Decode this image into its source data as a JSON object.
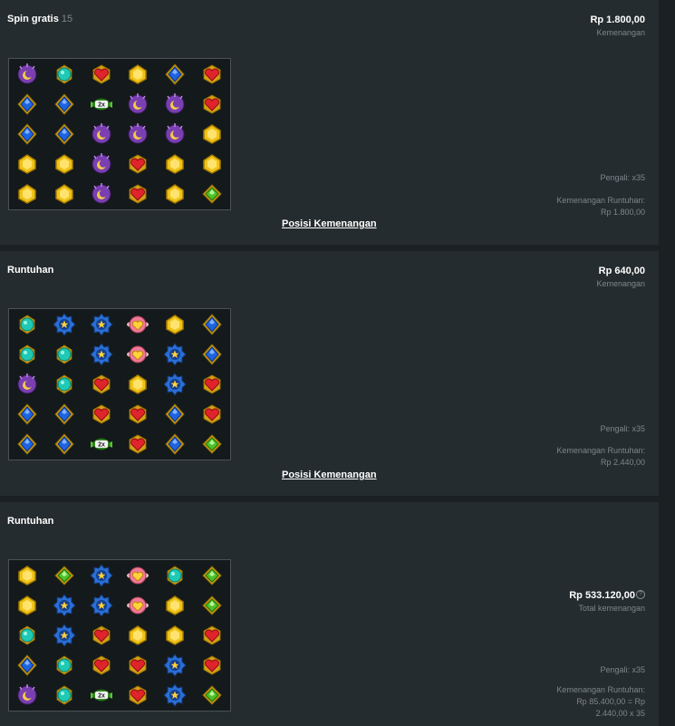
{
  "rounds": [
    {
      "title": "Spin gratis",
      "count": "15",
      "amount": "Rp 1.800,00",
      "amount_label": "Kemenangan",
      "multiplier": "Pengali: x35",
      "cascade_label": "Kemenangan Runtuhan:",
      "cascade_value": "Rp 1.800,00",
      "link": "Posisi Kemenangan",
      "grid": [
        [
          "purple-moon",
          "teal-orb",
          "red-heart",
          "yellow-gem",
          "blue-diamond",
          "red-heart"
        ],
        [
          "blue-diamond",
          "blue-diamond",
          "wild-2x",
          "purple-moon",
          "purple-moon",
          "red-heart"
        ],
        [
          "blue-diamond",
          "blue-diamond",
          "purple-moon",
          "purple-moon",
          "purple-moon",
          "yellow-gem"
        ],
        [
          "yellow-gem",
          "yellow-gem",
          "purple-moon",
          "red-heart",
          "yellow-gem",
          "yellow-gem"
        ],
        [
          "yellow-gem",
          "yellow-gem",
          "purple-moon",
          "red-heart",
          "yellow-gem",
          "green-emerald"
        ]
      ]
    },
    {
      "title": "Runtuhan",
      "amount": "Rp 640,00",
      "amount_label": "Kemenangan",
      "multiplier": "Pengali: x35",
      "cascade_label": "Kemenangan Runtuhan:",
      "cascade_value": "Rp 2.440,00",
      "link": "Posisi Kemenangan",
      "grid": [
        [
          "teal-orb",
          "blue-star",
          "blue-star",
          "pink-heart",
          "yellow-gem",
          "blue-diamond"
        ],
        [
          "teal-orb",
          "teal-orb",
          "blue-star",
          "pink-heart",
          "blue-star",
          "blue-diamond"
        ],
        [
          "purple-moon",
          "teal-orb",
          "red-heart",
          "yellow-gem",
          "blue-star",
          "red-heart"
        ],
        [
          "blue-diamond",
          "blue-diamond",
          "red-heart",
          "red-heart",
          "blue-diamond",
          "red-heart"
        ],
        [
          "blue-diamond",
          "blue-diamond",
          "wild-2x",
          "red-heart",
          "blue-diamond",
          "green-emerald"
        ]
      ]
    },
    {
      "title": "Runtuhan",
      "amount": "Rp 533.120,00",
      "amount_label": "Total kemenangan",
      "info_icon": "?",
      "multiplier": "Pengali: x35",
      "cascade_label": "Kemenangan Runtuhan:",
      "cascade_value_1": "Rp 85.400,00 = Rp",
      "cascade_value_2": "2.440,00 x 35",
      "grid": [
        [
          "yellow-gem",
          "green-emerald",
          "blue-star",
          "pink-heart",
          "teal-orb",
          "green-emerald"
        ],
        [
          "yellow-gem",
          "blue-star",
          "blue-star",
          "pink-heart",
          "yellow-gem",
          "green-emerald"
        ],
        [
          "teal-orb",
          "blue-star",
          "red-heart",
          "yellow-gem",
          "yellow-gem",
          "red-heart"
        ],
        [
          "blue-diamond",
          "teal-orb",
          "red-heart",
          "red-heart",
          "blue-star",
          "red-heart"
        ],
        [
          "purple-moon",
          "teal-orb",
          "wild-2x",
          "red-heart",
          "blue-star",
          "green-emerald"
        ]
      ]
    }
  ],
  "wild_label": "2x",
  "colors": {
    "background": "#1b2023",
    "panel": "#252c2f",
    "muted_text": "#7d868a"
  }
}
